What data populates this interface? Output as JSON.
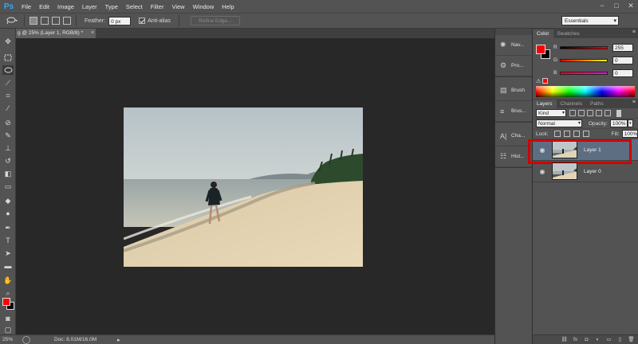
{
  "app": {
    "logo": "Ps"
  },
  "menu": [
    "File",
    "Edit",
    "Image",
    "Layer",
    "Type",
    "Select",
    "Filter",
    "View",
    "Window",
    "Help"
  ],
  "window_controls": [
    "−",
    "□",
    "✕"
  ],
  "options": {
    "feather_label": "Feather:",
    "feather_value": "0 px",
    "antialias_label": "Anti-alias",
    "refine_label": "Refine Edge...",
    "workspace": "Essentials"
  },
  "document": {
    "tab_title": "g @ 25% (Layer 1, RGB/8) *",
    "tab_close": "×"
  },
  "status": {
    "zoom": "25%",
    "doc_size": "Doc: 8.01M/16.0M",
    "arrow": "▸"
  },
  "dock": [
    {
      "label": "Nav...",
      "icon": "navigator-icon"
    },
    {
      "label": "Pro...",
      "icon": "properties-icon"
    },
    {
      "label": "Brush",
      "icon": "brush-icon"
    },
    {
      "label": "Brus...",
      "icon": "brush-presets-icon"
    },
    {
      "label": "Cha...",
      "icon": "character-icon"
    },
    {
      "label": "Hist...",
      "icon": "history-icon"
    }
  ],
  "color_panel": {
    "tabs": [
      "Color",
      "Swatches"
    ],
    "r_label": "R",
    "r_value": "255",
    "g_label": "G",
    "g_value": "0",
    "b_label": "B",
    "b_value": "0",
    "fg_color": "#ff0000",
    "bg_color": "#000000"
  },
  "layers_panel": {
    "tabs": [
      "Layers",
      "Channels",
      "Paths"
    ],
    "kind": "Kind",
    "blend_mode": "Normal",
    "opacity_label": "Opacity:",
    "opacity_value": "100%",
    "lock_label": "Lock:",
    "fill_label": "Fill:",
    "fill_value": "100%",
    "layers": [
      {
        "name": "Layer 1",
        "selected": true
      },
      {
        "name": "Layer 0",
        "selected": false
      }
    ],
    "highlight_color": "#d30000"
  }
}
